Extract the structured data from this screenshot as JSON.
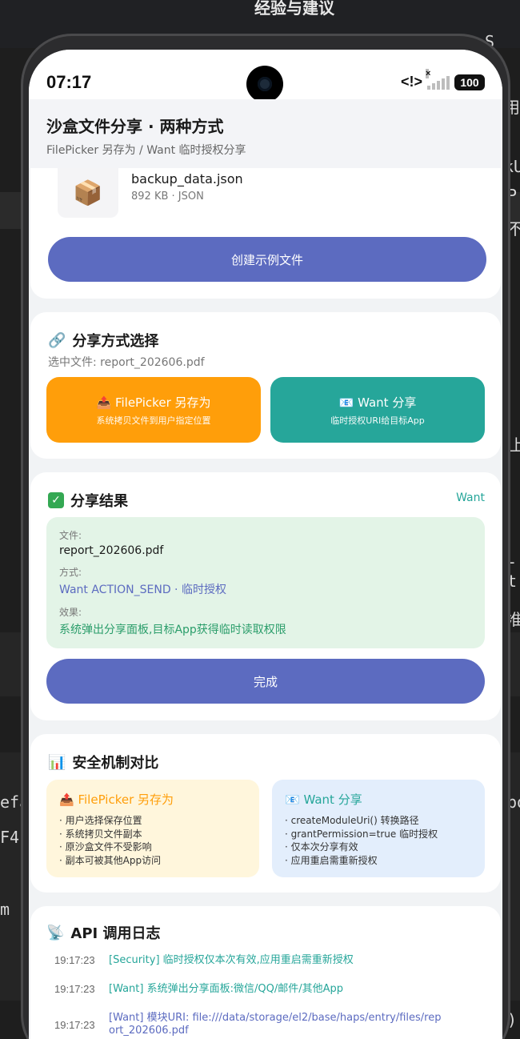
{
  "background": {
    "title": "经验与建议",
    "frags": [
      "S 中",
      "用",
      "kU",
      "P",
      "不",
      "上",
      "-t",
      "准",
      "efa",
      "F4",
      "m",
      "bo",
      ")"
    ]
  },
  "status_bar": {
    "time": "07:17",
    "dev_indicator": "<!>",
    "battery": "100"
  },
  "header": {
    "title": "沙盒文件分享 · 两种方式",
    "subtitle": "FilePicker 另存为 / Want 临时授权分享"
  },
  "file_card": {
    "file_icon": "package-icon",
    "file_name": "backup_data.json",
    "file_meta": "892 KB · JSON",
    "create_button": "创建示例文件"
  },
  "share_method": {
    "icon": "link-icon",
    "title": "分享方式选择",
    "selected_file": "选中文件: report_202606.pdf",
    "filepicker": {
      "icon": "outbox-icon",
      "title": "FilePicker 另存为",
      "sub": "系统拷贝文件到用户指定位置",
      "color": "#ff9e0a"
    },
    "want": {
      "icon": "id-card-icon",
      "title": "Want 分享",
      "sub": "临时授权URI给目标App",
      "color": "#26a69a"
    }
  },
  "result": {
    "icon": "check-icon",
    "title": "分享结果",
    "tag": "Want",
    "file_label": "文件:",
    "file_value": "report_202606.pdf",
    "method_label": "方式:",
    "method_value": "Want ACTION_SEND · 临时授权",
    "effect_label": "效果:",
    "effect_value": "系统弹出分享面板,目标App获得临时读取权限",
    "done_button": "完成"
  },
  "compare": {
    "icon": "bar-chart-icon",
    "title": "安全机制对比",
    "filepicker": {
      "title": "FilePicker 另存为",
      "items": [
        "· 用户选择保存位置",
        "· 系统拷贝文件副本",
        "· 原沙盒文件不受影响",
        "· 副本可被其他App访问"
      ]
    },
    "want": {
      "title": "Want 分享",
      "items": [
        "· createModuleUri() 转换路径",
        "· grantPermission=true 临时授权",
        "· 仅本次分享有效",
        "· 应用重启需重新授权"
      ]
    }
  },
  "log": {
    "icon": "satellite-icon",
    "title": "API 调用日志",
    "entries": [
      {
        "time": "19:17:23",
        "msg": "[Security] 临时授权仅本次有效,应用重启需重新授权",
        "color": "#26a69a"
      },
      {
        "time": "19:17:23",
        "msg": "[Want] 系统弹出分享面板:微信/QQ/邮件/其他App",
        "color": "#26a69a"
      },
      {
        "time": "19:17:23",
        "msg": "[Want] 模块URI: file:///data/storage/el2/base/haps/entry/files/report_202606.pdf",
        "color": "#5c6bc0"
      }
    ]
  },
  "colors": {
    "primary": "#5c6bc0",
    "orange": "#ff9e0a",
    "teal": "#26a69a",
    "result_bg": "#e3f4e7",
    "cmp_fp_bg": "#fff6dc",
    "cmp_want_bg": "#e3eefc"
  }
}
